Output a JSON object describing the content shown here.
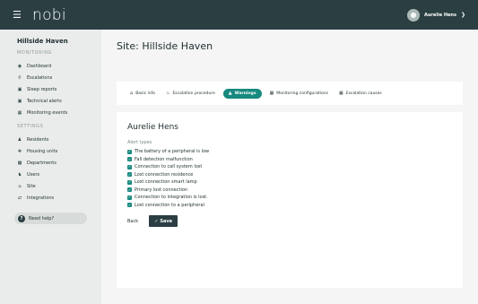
{
  "topbar": {
    "menu_icon": "hamburger-icon",
    "logo": "nobi",
    "user_name": "Aurelie Hens",
    "chevron": "chevron-down-icon"
  },
  "sidebar": {
    "site_name": "Hillside Haven",
    "monitoring_label": "MONITORING",
    "monitoring_items": [
      {
        "label": "Dashboard",
        "icon": "dashboard-icon"
      },
      {
        "label": "Escalations",
        "icon": "pin-icon"
      },
      {
        "label": "Sleep reports",
        "icon": "bed-icon"
      },
      {
        "label": "Technical alerts",
        "icon": "alert-box-icon"
      },
      {
        "label": "Monitoring events",
        "icon": "events-icon"
      }
    ],
    "settings_label": "SETTINGS",
    "settings_items": [
      {
        "label": "Residents",
        "icon": "people-icon"
      },
      {
        "label": "Housing units",
        "icon": "housing-icon"
      },
      {
        "label": "Departments",
        "icon": "building-icon"
      },
      {
        "label": "Users",
        "icon": "users-icon"
      },
      {
        "label": "Site",
        "icon": "home-icon"
      },
      {
        "label": "Integrations",
        "icon": "swap-icon"
      }
    ],
    "help_label": "Need help?"
  },
  "main": {
    "title": "Site: Hillside Haven",
    "tabs": [
      {
        "label": "Basic info",
        "icon": "home-icon",
        "active": false
      },
      {
        "label": "Escalation procedure",
        "icon": "bell-icon",
        "active": false
      },
      {
        "label": "Warnings",
        "icon": "warning-icon",
        "active": true
      },
      {
        "label": "Monitoring configurations",
        "icon": "config-icon",
        "active": false
      },
      {
        "label": "Escalation causes",
        "icon": "causes-icon",
        "active": false
      }
    ],
    "content": {
      "name": "Aurelie Hens",
      "alert_types_label": "Alert types",
      "alert_types": [
        "The battery of a peripheral is low",
        "Fall detection malfunction",
        "Connection to call system lost",
        "Lost connection residence",
        "Lost connection smart lamp",
        "Primary lost connection",
        "Connection to integration is lost.",
        "Lost connection to a peripheral"
      ],
      "back_label": "Back",
      "save_label": "Save"
    }
  },
  "colors": {
    "topbar": "#2b3f43",
    "accent": "#17897f",
    "background": "#e9eceb"
  }
}
